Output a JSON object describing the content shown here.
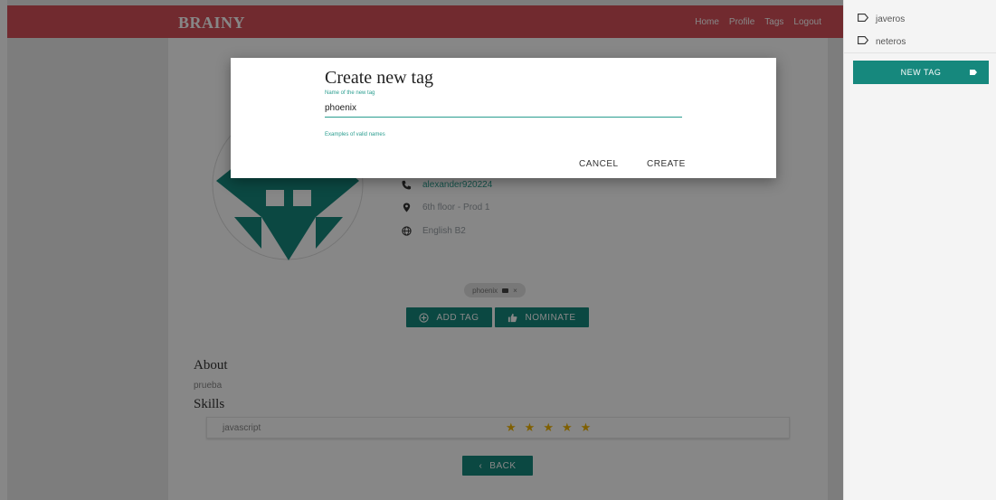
{
  "app": {
    "brand": "BRAINY"
  },
  "nav": {
    "items": [
      "Home",
      "Profile",
      "Tags",
      "Logout"
    ]
  },
  "profile": {
    "contact": {
      "phone": "alexander920224",
      "location": "6th floor - Prod 1",
      "language": "English B2"
    },
    "chip": {
      "label": "phoenix"
    },
    "actions": {
      "add_tag": "ADD TAG",
      "nominate": "NOMINATE",
      "back": "BACK"
    },
    "about": {
      "title": "About",
      "text": "prueba"
    },
    "skills": {
      "title": "Skills",
      "items": [
        {
          "name": "javascript",
          "stars": 5
        }
      ]
    }
  },
  "sidebar": {
    "tags": [
      {
        "label": "javeros"
      },
      {
        "label": "neteros"
      }
    ],
    "new_tag_button": "NEW TAG"
  },
  "dialog": {
    "title": "Create new tag",
    "field_label": "Name of the new tag",
    "input_value": "phoenix",
    "examples_link": "Examples of valid names",
    "cancel": "CANCEL",
    "create": "CREATE"
  },
  "colors": {
    "brand_bar": "#d6505a",
    "accent": "#16887d",
    "link": "#2a9d8f",
    "star": "#f0b400"
  },
  "icons": [
    "phone-icon",
    "location-pin-icon",
    "globe-icon",
    "add-circle-icon",
    "thumbs-up-icon",
    "chevron-left-icon",
    "tag-outline-icon",
    "tag-icon",
    "star-icon"
  ]
}
